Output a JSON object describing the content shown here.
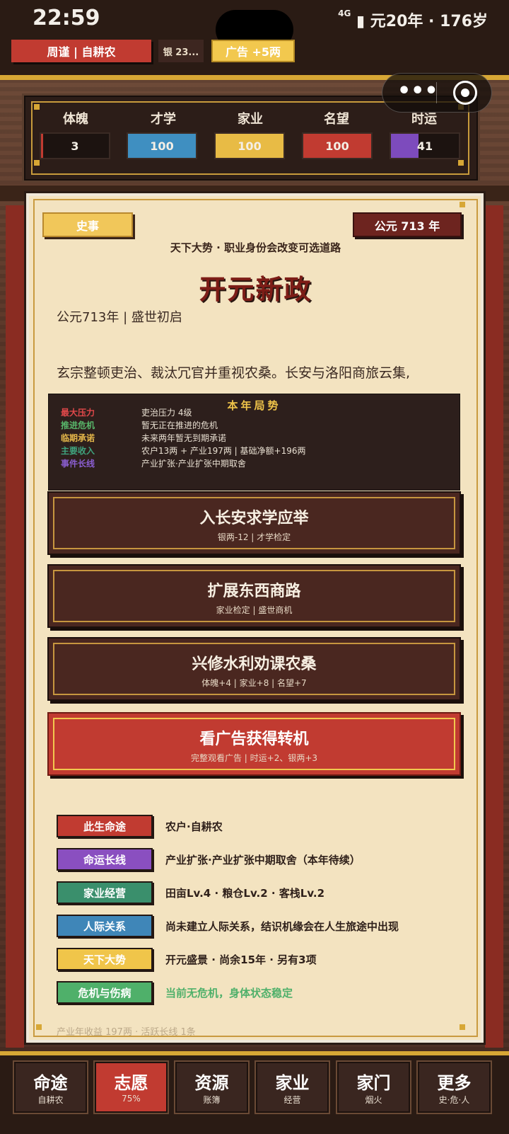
{
  "status_bar": {
    "time": "22:59",
    "right_text": "元20年 · 176岁",
    "network": "4G"
  },
  "header": {
    "identity": "周谨 | 自耕农",
    "silver": "银 23...",
    "ad_button": "广告 +5两"
  },
  "stats": [
    {
      "label": "体魄",
      "value": "3",
      "fill": 0.03,
      "color": "#c13b31"
    },
    {
      "label": "才学",
      "value": "100",
      "fill": 1.0,
      "color": "#3f8fc1"
    },
    {
      "label": "家业",
      "value": "100",
      "fill": 1.0,
      "color": "#e8bb45"
    },
    {
      "label": "名望",
      "value": "100",
      "fill": 1.0,
      "color": "#c13b31"
    },
    {
      "label": "时运",
      "value": "41",
      "fill": 0.41,
      "color": "#7d4bbd"
    }
  ],
  "event": {
    "tag": "史事",
    "year": "公元 713 年",
    "trend_line": "天下大势 · 职业身份会改变可选道路",
    "title": "开元新政",
    "subtitle": "公元713年 | 盛世初启",
    "body": "玄宗整顿吏治、裁汰冗官并重视农桑。长安与洛阳商旅云集,"
  },
  "situation": {
    "title": "本年局势",
    "rows": [
      {
        "key": "最大压力",
        "value": "吏治压力 4级",
        "color": "#e0484a"
      },
      {
        "key": "推进危机",
        "value": "暂无正在推进的危机",
        "color": "#58b66a"
      },
      {
        "key": "临期承诺",
        "value": "未来两年暂无到期承诺",
        "color": "#e6b84a"
      },
      {
        "key": "主要收入",
        "value": "农户13两 + 产业197两 | 基础净额+196两",
        "color": "#3fa37e"
      },
      {
        "key": "事件长线",
        "value": "产业扩张·产业扩张中期取舍",
        "color": "#8a5ed0"
      }
    ]
  },
  "choices": [
    {
      "title": "入长安求学应举",
      "sub": "银两-12 | 才学检定"
    },
    {
      "title": "扩展东西商路",
      "sub": "家业检定 | 盛世商机"
    },
    {
      "title": "兴修水利劝课农桑",
      "sub": "体魄+4 | 家业+8 | 名望+7"
    },
    {
      "title": "看广告获得转机",
      "sub": "完整观看广告 | 时运+2、银两+3"
    }
  ],
  "info": [
    {
      "tag": "此生命途",
      "text": "农户·自耕农",
      "color": "#c13b31"
    },
    {
      "tag": "命运长线",
      "text": "产业扩张·产业扩张中期取舍（本年待续）",
      "color": "#8a4fc0"
    },
    {
      "tag": "家业经营",
      "text": "田亩Lv.4 · 粮仓Lv.2 · 客栈Lv.2",
      "color": "#3a8f6c"
    },
    {
      "tag": "人际关系",
      "text": "尚未建立人际关系，结识机缘会在人生旅途中出现",
      "color": "#3f86b8"
    },
    {
      "tag": "天下大势",
      "text": "开元盛景 · 尚余15年 · 另有3项",
      "color": "#f0c54a"
    },
    {
      "tag": "危机与伤病",
      "text": "当前无危机，身体状态稳定",
      "color": "#4fb06a"
    }
  ],
  "footer_note": "产业年收益 197两 · 活跃长线 1条",
  "nav": [
    {
      "label": "命途",
      "sub": "自耕农"
    },
    {
      "label": "志愿",
      "sub": "75%"
    },
    {
      "label": "资源",
      "sub": "账簿"
    },
    {
      "label": "家业",
      "sub": "经营"
    },
    {
      "label": "家门",
      "sub": "烟火"
    },
    {
      "label": "更多",
      "sub": "史·危·人"
    }
  ],
  "nav_active": "志愿"
}
